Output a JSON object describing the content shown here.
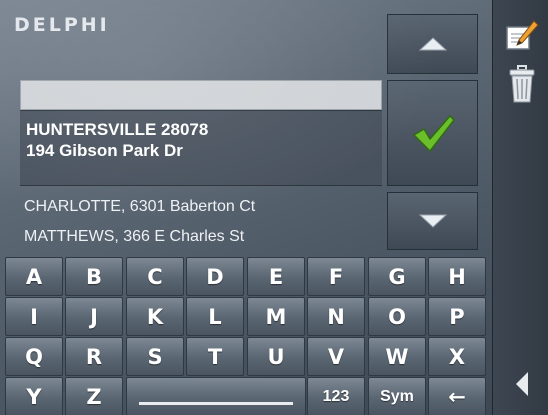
{
  "brand": {
    "logo_text": "DELPHI"
  },
  "entry": {
    "value": ""
  },
  "selected_result": {
    "line1": "HUNTERSVILLE 28078",
    "line2": "194 Gibson Park Dr"
  },
  "results": [
    "CHARLOTTE, 6301 Baberton Ct",
    "MATTHEWS, 366 E Charles St"
  ],
  "nav": {
    "up_icon": "triangle-up-icon",
    "confirm_icon": "checkmark-icon",
    "down_icon": "triangle-down-icon"
  },
  "keyboard": {
    "rows": [
      [
        "A",
        "B",
        "C",
        "D",
        "E",
        "F",
        "G",
        "H"
      ],
      [
        "I",
        "J",
        "K",
        "L",
        "M",
        "N",
        "O",
        "P"
      ],
      [
        "Q",
        "R",
        "S",
        "T",
        "U",
        "V",
        "W",
        "X"
      ],
      [
        "Y",
        "Z",
        "",
        "",
        "",
        "123",
        "Sym",
        "←"
      ]
    ]
  },
  "right_panel": {
    "icons": [
      "notepad-icon",
      "trash-icon",
      "back-arrow-icon"
    ]
  },
  "colors": {
    "check_green": "#6bbf2a",
    "key_top": "#7d8894",
    "key_bottom": "#4b5561"
  }
}
